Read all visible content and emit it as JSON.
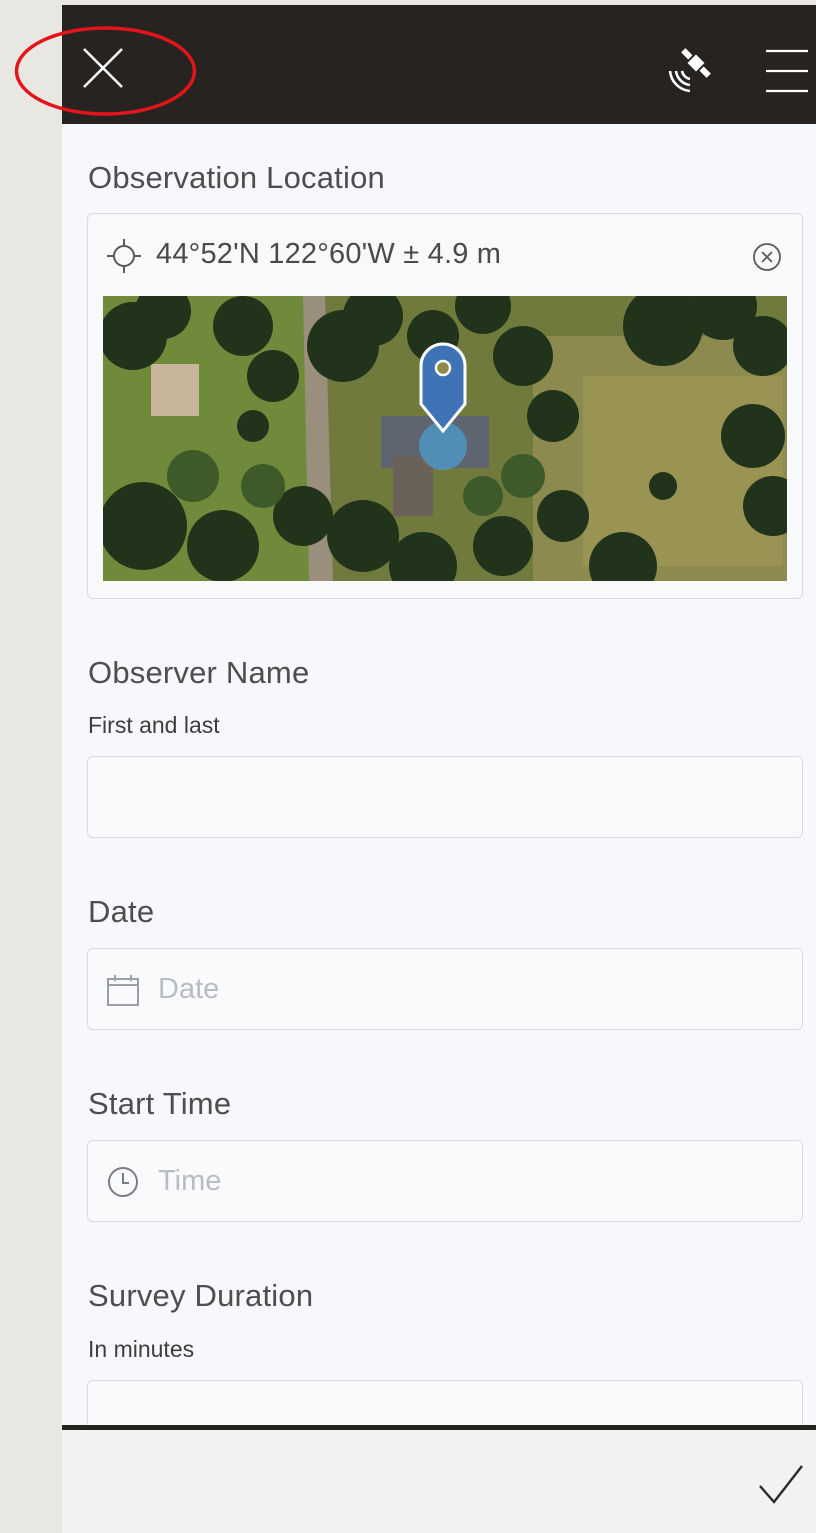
{
  "header": {
    "close_icon": "close-icon",
    "gps_icon": "gps-satellite-icon",
    "menu_icon": "hamburger-menu-icon",
    "colors": {
      "bar": "#262320",
      "icon": "#ffffff",
      "highlight_ring": "#e3151b"
    }
  },
  "form": {
    "location": {
      "label": "Observation Location",
      "coordinates": "44°52'N 122°60'W ± 4.9 m",
      "crosshair_icon": "crosshair-icon",
      "clear_icon": "clear-circle-x-icon",
      "pin_color": "#3f73b5"
    },
    "observer": {
      "label": "Observer Name",
      "hint": "First and last",
      "value": ""
    },
    "date": {
      "label": "Date",
      "placeholder": "Date",
      "icon": "calendar-icon"
    },
    "start_time": {
      "label": "Start Time",
      "placeholder": "Time",
      "icon": "clock-icon"
    },
    "duration": {
      "label": "Survey Duration",
      "hint": "In minutes",
      "value": ""
    }
  },
  "footer": {
    "submit_icon": "checkmark-icon"
  }
}
